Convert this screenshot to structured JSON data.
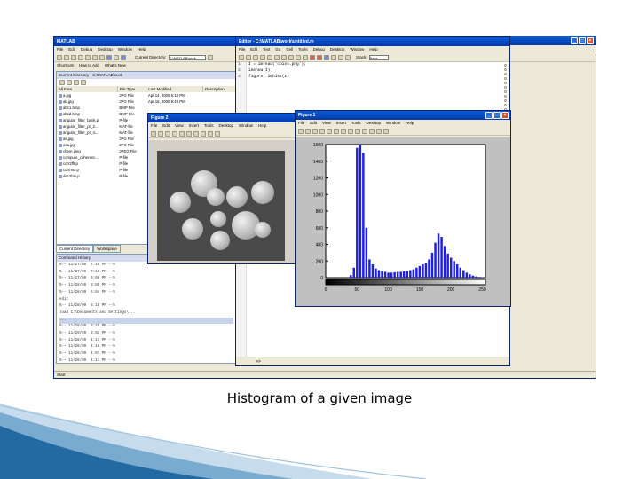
{
  "caption": "Histogram of a given image",
  "matlab": {
    "title": "MATLAB",
    "menu": [
      "File",
      "Edit",
      "Debug",
      "Desktop",
      "Window",
      "Help"
    ],
    "shortcuts": [
      "Shortcuts",
      "How to Add",
      "What's New"
    ],
    "current_directory_label": "Current Directory:",
    "current_directory_value": "C:\\MATLAB\\work",
    "curdir_panel_title": "Current Directory - C:\\MATLAB\\work",
    "columns": [
      "All Files",
      "File Type",
      "Last Modified",
      "Description"
    ],
    "files": [
      {
        "name": "a.jpg",
        "type": "JPG File",
        "modified": "Apr 14, 2008 6:13 PM"
      },
      {
        "name": "ab.jpg",
        "type": "JPG File",
        "modified": "Apr 16, 2008 9:43 PM"
      },
      {
        "name": "abc1.bmp",
        "type": "BMP File",
        "modified": ""
      },
      {
        "name": "abcd.bmp",
        "type": "BMP File",
        "modified": ""
      },
      {
        "name": "angular_filter_bank.p",
        "type": "P-file",
        "modified": ""
      },
      {
        "name": "angular_filter_pr_2...",
        "type": "MAT-file",
        "modified": ""
      },
      {
        "name": "angular_filter_pr_4...",
        "type": "MAT-file",
        "modified": ""
      },
      {
        "name": "as.jpg",
        "type": "JPG File",
        "modified": ""
      },
      {
        "name": "asa.jpg",
        "type": "JPG File",
        "modified": ""
      },
      {
        "name": "chem.jpeg",
        "type": "JPEG File",
        "modified": ""
      },
      {
        "name": "compute_coherenc...",
        "type": "P-file",
        "modified": ""
      },
      {
        "name": "corr2fft.p",
        "type": "P-file",
        "modified": ""
      },
      {
        "name": "corrmtx.p",
        "type": "P-file",
        "modified": ""
      },
      {
        "name": "dec2bin.p",
        "type": "P-file",
        "modified": ""
      }
    ],
    "tabs": [
      "Current Directory",
      "Workspace"
    ],
    "history_title": "Command History",
    "history": [
      "%-- 11/27/09  7:16 PM --%",
      "%-- 11/27/09  7:16 PM --%",
      "%-- 11/27/09  9:08 PM --%",
      "%-- 11/28/09  3:05 PM --%",
      "%-- 11/28/09  6:04 PM --%",
      "edit",
      "%-- 11/28/09  6:18 PM --%",
      "load C:\\Documents and Settings\\...",
      "...",
      "%-- 11/28/09  3:25 PM --%",
      "%-- 11/29/09  3:02 PM --%",
      "%-- 11/28/09  4:13 PM --%",
      "%-- 11/28/09  4:16 PM --%",
      "%-- 11/28/09  4:07 PM --%",
      "%-- 11/28/09  4:13 PM --%",
      "%-- 11/28/09  6:12 PM --%"
    ],
    "start_label": "Start"
  },
  "editor": {
    "title": "Editor - C:\\MATLAB\\work\\untitled.m",
    "menu": [
      "File",
      "Edit",
      "Text",
      "Go",
      "Cell",
      "Tools",
      "Debug",
      "Desktop",
      "Window",
      "Help"
    ],
    "stack_label": "Stack:",
    "stack_value": "Base",
    "lines": [
      {
        "n": "1",
        "text": "I = imread('coins.png');"
      },
      {
        "n": "2",
        "text": "imshow(I)"
      },
      {
        "n": "3",
        "text": "figure, imhist(I)"
      }
    ],
    "bottom_label": ">>"
  },
  "figure2": {
    "title": "Figure 2",
    "menu": [
      "File",
      "Edit",
      "View",
      "Insert",
      "Tools",
      "Desktop",
      "Window",
      "Help"
    ]
  },
  "figure1": {
    "title": "Figure 1",
    "menu": [
      "File",
      "Edit",
      "View",
      "Insert",
      "Tools",
      "Desktop",
      "Window",
      "Help"
    ]
  },
  "chart_data": {
    "type": "bar",
    "xlim": [
      0,
      255
    ],
    "ylim": [
      0,
      1600
    ],
    "yticks": [
      0,
      200,
      400,
      600,
      800,
      1000,
      1200,
      1400,
      1600
    ],
    "xticks": [
      0,
      50,
      100,
      150,
      200,
      250
    ],
    "colors": {
      "bars": "#1f1fe0",
      "axis": "#000000"
    },
    "x": [
      40,
      45,
      50,
      55,
      60,
      65,
      70,
      75,
      80,
      85,
      90,
      95,
      100,
      105,
      110,
      115,
      120,
      125,
      130,
      135,
      140,
      145,
      150,
      155,
      160,
      165,
      170,
      175,
      180,
      185,
      190,
      195,
      200,
      205,
      210,
      215,
      220,
      225,
      230,
      235,
      240,
      245,
      250
    ],
    "values": [
      30,
      120,
      1560,
      1600,
      1500,
      600,
      220,
      160,
      110,
      90,
      80,
      70,
      60,
      60,
      65,
      70,
      70,
      75,
      80,
      90,
      100,
      120,
      140,
      160,
      180,
      220,
      300,
      420,
      530,
      490,
      380,
      290,
      240,
      200,
      160,
      120,
      90,
      60,
      40,
      25,
      15,
      8,
      4
    ]
  }
}
